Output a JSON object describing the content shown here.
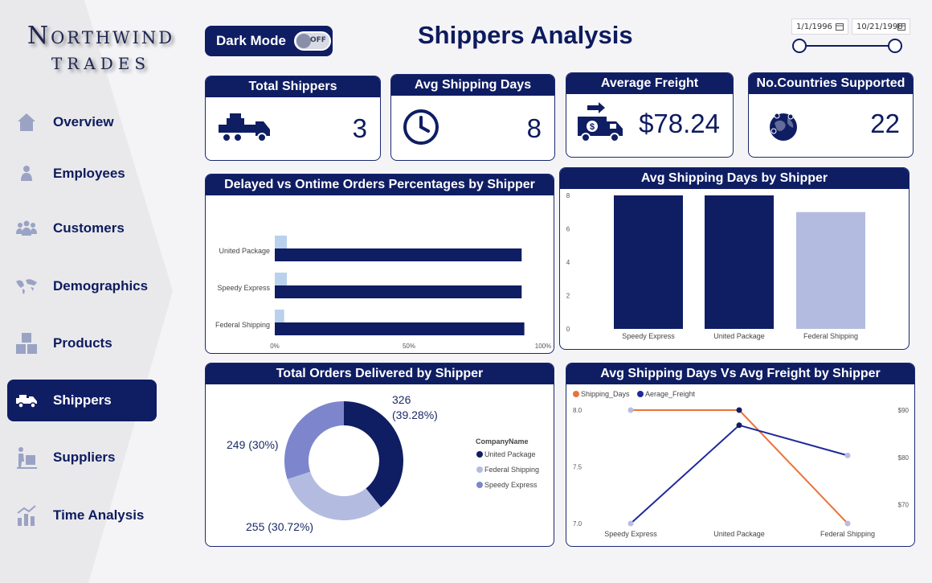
{
  "logo": {
    "line1": "Northwind",
    "line2": "TRADES"
  },
  "nav": {
    "items": [
      {
        "label": "Overview",
        "icon": "home-icon"
      },
      {
        "label": "Employees",
        "icon": "person-icon"
      },
      {
        "label": "Customers",
        "icon": "people-icon"
      },
      {
        "label": "Demographics",
        "icon": "world-map-icon"
      },
      {
        "label": "Products",
        "icon": "boxes-icon"
      },
      {
        "label": "Shippers",
        "icon": "truck-icon",
        "active": true
      },
      {
        "label": "Suppliers",
        "icon": "dolly-icon"
      },
      {
        "label": "Time Analysis",
        "icon": "growth-chart-icon"
      }
    ]
  },
  "header": {
    "dark_mode_label": "Dark Mode",
    "toggle_state": "OFF",
    "title": "Shippers Analysis",
    "date_from": "1/1/1996",
    "date_to": "10/21/1998"
  },
  "kpis": {
    "total_shippers": {
      "title": "Total Shippers",
      "value": "3"
    },
    "avg_shipping_days": {
      "title": "Avg Shipping Days",
      "value": "8"
    },
    "average_freight": {
      "title": "Average Freight",
      "value": "$78.24"
    },
    "countries": {
      "title": "No.Countries Supported",
      "value": "22"
    }
  },
  "colors": {
    "navy": "#0f1d63",
    "light_blue": "#b9d1ec",
    "lavender": "#b3bce0",
    "periwinkle": "#7d86cc",
    "orange": "#e8743b",
    "mid_blue": "#1e2a9a"
  },
  "chart_data": [
    {
      "type": "bar",
      "orientation": "horizontal",
      "title": "Delayed vs Ontime Orders Percentages by Shipper",
      "categories": [
        "United Package",
        "Speedy Express",
        "Federal Shipping"
      ],
      "series": [
        {
          "values": [
            4.5,
            4.5,
            3.5
          ]
        },
        {
          "values": [
            92,
            92,
            93
          ]
        }
      ],
      "xticks": [
        "0%",
        "50%",
        "100%"
      ],
      "xlim": [
        0,
        100
      ]
    },
    {
      "type": "bar",
      "title": "Avg Shipping Days by Shipper",
      "categories": [
        "Speedy Express",
        "United Package",
        "Federal Shipping"
      ],
      "values": [
        8,
        8,
        7
      ],
      "yticks": [
        "0",
        "2",
        "4",
        "6",
        "8"
      ],
      "ylim": [
        0,
        8
      ]
    },
    {
      "type": "pie",
      "title": "Total Orders Delivered by Shipper",
      "legend_title": "CompanyName",
      "slices": [
        {
          "label": "United Package",
          "value": 326,
          "data_label": "326\n(39.28%)"
        },
        {
          "label": "Federal Shipping",
          "value": 255,
          "data_label": "255 (30.72%)"
        },
        {
          "label": "Speedy Express",
          "value": 249,
          "data_label": "249 (30%)"
        }
      ]
    },
    {
      "type": "line",
      "title": "Avg Shipping Days Vs Avg Freight by Shipper",
      "categories": [
        "Speedy Express",
        "United Package",
        "Federal Shipping"
      ],
      "series": [
        {
          "name": "Shipping_Days",
          "axis": "left",
          "values": [
            8.0,
            8.0,
            7.0
          ]
        },
        {
          "name": "Aerage_Freight",
          "axis": "right",
          "values": [
            66.0,
            86.8,
            80.4
          ]
        }
      ],
      "left_ticks": [
        "8.0",
        "7.5",
        "7.0"
      ],
      "right_ticks": [
        "$90",
        "$80",
        "$70"
      ],
      "left_range": [
        7.0,
        8.0
      ],
      "right_range": [
        66,
        90
      ]
    }
  ]
}
